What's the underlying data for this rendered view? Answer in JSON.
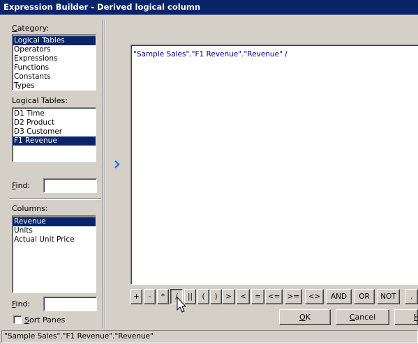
{
  "window": {
    "title": "Expression Builder - Derived logical column"
  },
  "category": {
    "label": "Category:",
    "items": [
      "Logical Tables",
      "Operators",
      "Expressions",
      "Functions",
      "Constants",
      "Types"
    ],
    "selected": "Logical Tables"
  },
  "logical_tables": {
    "label": "Logical Tables:",
    "items": [
      "D1 Time",
      "D2 Product",
      "D3 Customer",
      "F1 Revenue"
    ],
    "selected": "F1 Revenue"
  },
  "find_tables": {
    "label": "Find:",
    "value": ""
  },
  "columns": {
    "label": "Columns:",
    "items": [
      "Revenue",
      "Units",
      "Actual Unit Price"
    ],
    "selected": "Revenue"
  },
  "find_columns": {
    "label": "Find:",
    "value": ""
  },
  "sort_panes": {
    "label": "Sort Panes",
    "checked": false
  },
  "insert_arrow": {
    "icon": "chevron-right-icon",
    "color": "#1f6fd8"
  },
  "expression": {
    "text": "\"Sample Sales\".\"F1 Revenue\".\"Revenue\" /"
  },
  "operators": [
    "+",
    "-",
    "*",
    "/",
    "||",
    "(",
    ")",
    ">",
    "<",
    "=",
    "<=",
    ">=",
    "<>",
    "AND",
    "OR",
    "NOT",
    ","
  ],
  "dialog_buttons": {
    "ok": "OK",
    "cancel": "Cancel",
    "help": "H"
  },
  "status": {
    "text": "\"Sample Sales\".\"F1 Revenue\".\"Revenue\""
  },
  "colors": {
    "titlebar": "#0a246a",
    "selection": "#0a246a",
    "face": "#d4d0c8",
    "expression_text": "#00008b"
  }
}
